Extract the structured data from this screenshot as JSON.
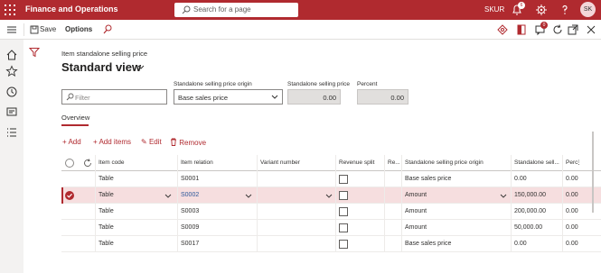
{
  "topbar": {
    "app_title": "Finance and Operations",
    "search_placeholder": "Search for a page",
    "company": "SKUR",
    "notification_count": "6",
    "avatar_initials": "SK"
  },
  "actionbar": {
    "save_label": "Save",
    "options_label": "Options",
    "right_badge": "0"
  },
  "page": {
    "breadcrumb": "Item standalone selling price",
    "view_title": "Standard view",
    "filter_placeholder": "Filter",
    "origin_label": "Standalone selling price origin",
    "origin_value": "Base sales price",
    "ssp_label": "Standalone selling price",
    "ssp_value": "0.00",
    "percent_label": "Percent",
    "percent_value": "0.00",
    "tab_overview": "Overview"
  },
  "commands": {
    "add": "Add",
    "add_items": "Add items",
    "edit": "Edit",
    "remove": "Remove"
  },
  "grid": {
    "headers": {
      "item_code": "Item code",
      "item_relation": "Item relation",
      "variant_number": "Variant number",
      "revenue_split": "Revenue split",
      "re": "Re...",
      "origin": "Standalone selling price origin",
      "ssp": "Standalone sell...",
      "pct": "Perc"
    },
    "rows": [
      {
        "item_code": "Table",
        "item_relation": "S0001",
        "origin": "Base sales price",
        "ssp": "0.00",
        "pct": "0.00",
        "selected": false
      },
      {
        "item_code": "Table",
        "item_relation": "S0002",
        "origin": "Amount",
        "ssp": "150,000.00",
        "pct": "0.00",
        "selected": true
      },
      {
        "item_code": "Table",
        "item_relation": "S0003",
        "origin": "Amount",
        "ssp": "200,000.00",
        "pct": "0.00",
        "selected": false
      },
      {
        "item_code": "Table",
        "item_relation": "S0009",
        "origin": "Amount",
        "ssp": "50,000.00",
        "pct": "0.00",
        "selected": false
      },
      {
        "item_code": "Table",
        "item_relation": "S0017",
        "origin": "Base sales price",
        "ssp": "0.00",
        "pct": "0.00",
        "selected": false
      }
    ]
  },
  "icons": {
    "waffle": "waffle-icon",
    "search": "search-icon",
    "bell": "bell-icon",
    "gear": "gear-icon",
    "help": "help-icon",
    "hamburger": "hamburger-icon",
    "save": "save-icon",
    "find": "find-icon",
    "home": "home-icon",
    "star": "star-icon",
    "clock": "clock-icon",
    "workspaces": "workspaces-icon",
    "list": "list-icon",
    "filter": "filter-icon",
    "refresh": "refresh-icon"
  },
  "colors": {
    "brand": "#b02a2f",
    "selected_row": "#f6dedf",
    "link": "#2b579a"
  }
}
